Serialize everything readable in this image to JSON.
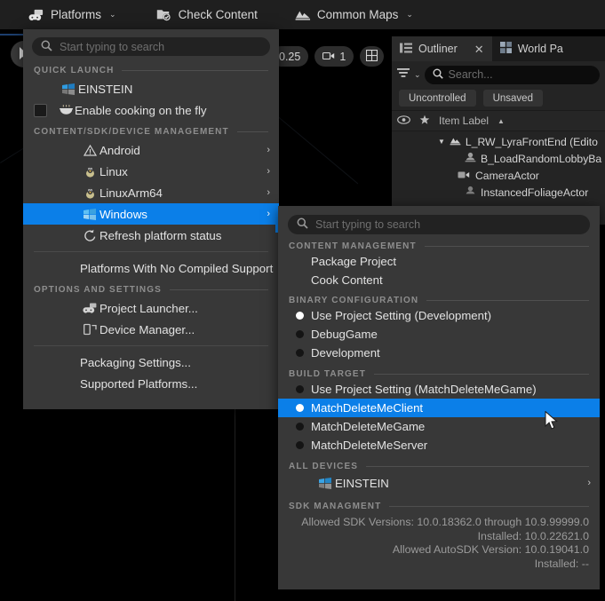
{
  "toolbar": {
    "items": [
      {
        "label": "Platforms",
        "icon": "platforms-icon",
        "caret": "⌄"
      },
      {
        "label": "Check Content",
        "icon": "check-content-icon",
        "caret": ""
      },
      {
        "label": "Common Maps",
        "icon": "common-maps-icon",
        "caret": "⌄"
      }
    ]
  },
  "viewport": {
    "chips": [
      {
        "label": "0.25",
        "icon": ""
      },
      {
        "label": "1",
        "icon": "camera-icon"
      },
      {
        "label": "",
        "icon": "layout-grid-icon"
      }
    ],
    "select_tool": "select-cursor-icon"
  },
  "outliner": {
    "tabs": [
      {
        "label": "Outliner",
        "icon": "outliner-icon",
        "close": "✕",
        "active": true
      },
      {
        "label": "World Pa",
        "icon": "world-partition-icon",
        "close": "",
        "active": false
      }
    ],
    "filter_icon": "filter-icon",
    "filter_caret": "⌄",
    "search_placeholder": "Search...",
    "search_icon": "search-icon",
    "tags": [
      "Uncontrolled",
      "Unsaved"
    ],
    "columns": {
      "eye": "eye-icon",
      "star": "star-icon",
      "item_label": "Item Label",
      "sort_arrow": "▲"
    },
    "rows": [
      {
        "label": "L_RW_LyraFrontEnd (Edito",
        "indent": 52,
        "icon": "level-icon",
        "expander": "▼"
      },
      {
        "label": "B_LoadRandomLobbyBa",
        "indent": 82,
        "icon": "blueprint-actor-icon",
        "expander": ""
      },
      {
        "label": "CameraActor",
        "indent": 74,
        "icon": "camera-actor-icon",
        "expander": ""
      },
      {
        "label": "InstancedFoliageActor",
        "indent": 82,
        "icon": "foliage-actor-icon",
        "expander": ""
      }
    ]
  },
  "platform_menu": {
    "search_placeholder": "Start typing to search",
    "search_icon": "search-icon",
    "sections": [
      {
        "title": "QUICK LAUNCH",
        "items": [
          {
            "label": "EINSTEIN",
            "icon": "windows-icon",
            "arrow": "",
            "checkbox": false,
            "selected": false
          },
          {
            "label": "Enable cooking on the fly",
            "icon": "cook-on-the-fly-icon",
            "arrow": "",
            "checkbox": true,
            "selected": false
          }
        ]
      },
      {
        "title": "CONTENT/SDK/DEVICE MANAGEMENT",
        "items": [
          {
            "label": "Android",
            "icon": "android-warning-icon",
            "arrow": "›",
            "checkbox": false,
            "selected": false
          },
          {
            "label": "Linux",
            "icon": "linux-icon",
            "arrow": "›",
            "checkbox": false,
            "selected": false
          },
          {
            "label": "LinuxArm64",
            "icon": "linux-icon",
            "arrow": "›",
            "checkbox": false,
            "selected": false
          },
          {
            "label": "Windows",
            "icon": "windows-icon",
            "arrow": "›",
            "checkbox": false,
            "selected": true
          },
          {
            "label": "Refresh platform status",
            "icon": "refresh-icon",
            "arrow": "",
            "checkbox": false,
            "selected": false
          }
        ]
      }
    ],
    "no_compiled_support": {
      "label": "Platforms With No Compiled Support",
      "arrow": "›"
    },
    "options_section": {
      "title": "OPTIONS AND SETTINGS",
      "items": [
        {
          "label": "Project Launcher...",
          "icon": "project-launcher-icon"
        },
        {
          "label": "Device Manager...",
          "icon": "device-manager-icon"
        }
      ]
    },
    "footer_items": [
      {
        "label": "Packaging Settings..."
      },
      {
        "label": "Supported Platforms..."
      }
    ]
  },
  "windows_submenu": {
    "search_placeholder": "Start typing to search",
    "search_icon": "search-icon",
    "content_management": {
      "title": "CONTENT MANAGEMENT",
      "items": [
        {
          "label": "Package Project"
        },
        {
          "label": "Cook Content"
        }
      ]
    },
    "binary_configuration": {
      "title": "BINARY CONFIGURATION",
      "items": [
        {
          "label": "Use Project Setting (Development)",
          "checked": true,
          "selected": false
        },
        {
          "label": "DebugGame",
          "checked": false,
          "selected": false
        },
        {
          "label": "Development",
          "checked": false,
          "selected": false
        }
      ]
    },
    "build_target": {
      "title": "BUILD TARGET",
      "items": [
        {
          "label": "Use Project Setting (MatchDeleteMeGame)",
          "checked": false,
          "selected": false
        },
        {
          "label": "MatchDeleteMeClient",
          "checked": true,
          "selected": true
        },
        {
          "label": "MatchDeleteMeGame",
          "checked": false,
          "selected": false
        },
        {
          "label": "MatchDeleteMeServer",
          "checked": false,
          "selected": false
        }
      ]
    },
    "all_devices": {
      "title": "ALL DEVICES",
      "items": [
        {
          "label": "EINSTEIN",
          "icon": "windows-icon",
          "arrow": "›"
        }
      ]
    },
    "sdk_management": {
      "title": "SDK MANAGMENT",
      "lines": [
        "Allowed SDK Versions: 10.0.18362.0 through 10.9.99999.0",
        "Installed: 10.0.22621.0",
        "Allowed AutoSDK Version: 10.0.19041.0",
        "Installed: --"
      ]
    }
  },
  "colors": {
    "accent_blue": "#0b7fe8",
    "menu_bg": "#383838",
    "panel_bg": "#242424",
    "toolbar_bg": "#1f1f1f"
  }
}
